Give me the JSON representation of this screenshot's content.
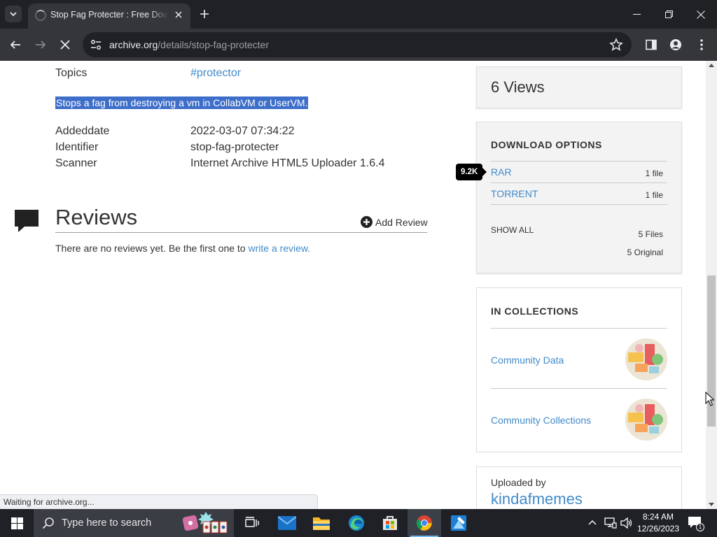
{
  "browser": {
    "tab_title": "Stop Fag Protecter : Free Download, Borrow, and Streaming : Internet Archive",
    "url_host": "archive.org",
    "url_path": "/details/stop-fag-protecter",
    "status_text": "Waiting for archive.org..."
  },
  "metadata": {
    "topics_label": "Topics",
    "topics_value": "#protector",
    "description": "Stops a fag from destroying a vm in CollabVM or UserVM.",
    "rows": [
      {
        "label": "Addeddate",
        "value": "2022-03-07 07:34:22"
      },
      {
        "label": "Identifier",
        "value": "stop-fag-protecter"
      },
      {
        "label": "Scanner",
        "value": "Internet Archive HTML5 Uploader 1.6.4"
      }
    ]
  },
  "reviews": {
    "title": "Reviews",
    "add_label": "Add Review",
    "empty_prefix": "There are no reviews yet. Be the first one to ",
    "empty_link": "write a review",
    "empty_suffix": "."
  },
  "sidebar": {
    "views": "6 Views",
    "download": {
      "heading": "DOWNLOAD OPTIONS",
      "badge": "9.2K",
      "items": [
        {
          "name": "RAR",
          "count": "1 file"
        },
        {
          "name": "TORRENT",
          "count": "1 file"
        }
      ],
      "show_all": "SHOW ALL",
      "files_count": "5 Files",
      "original_count": "5 Original"
    },
    "collections": {
      "heading": "IN COLLECTIONS",
      "items": [
        {
          "name": "Community Data"
        },
        {
          "name": "Community Collections"
        }
      ]
    },
    "uploader": {
      "label": "Uploaded by",
      "name": "kindafmemes"
    }
  },
  "taskbar": {
    "search_placeholder": "Type here to search",
    "time": "8:24 AM",
    "date": "12/26/2023",
    "notification_count": "1"
  }
}
